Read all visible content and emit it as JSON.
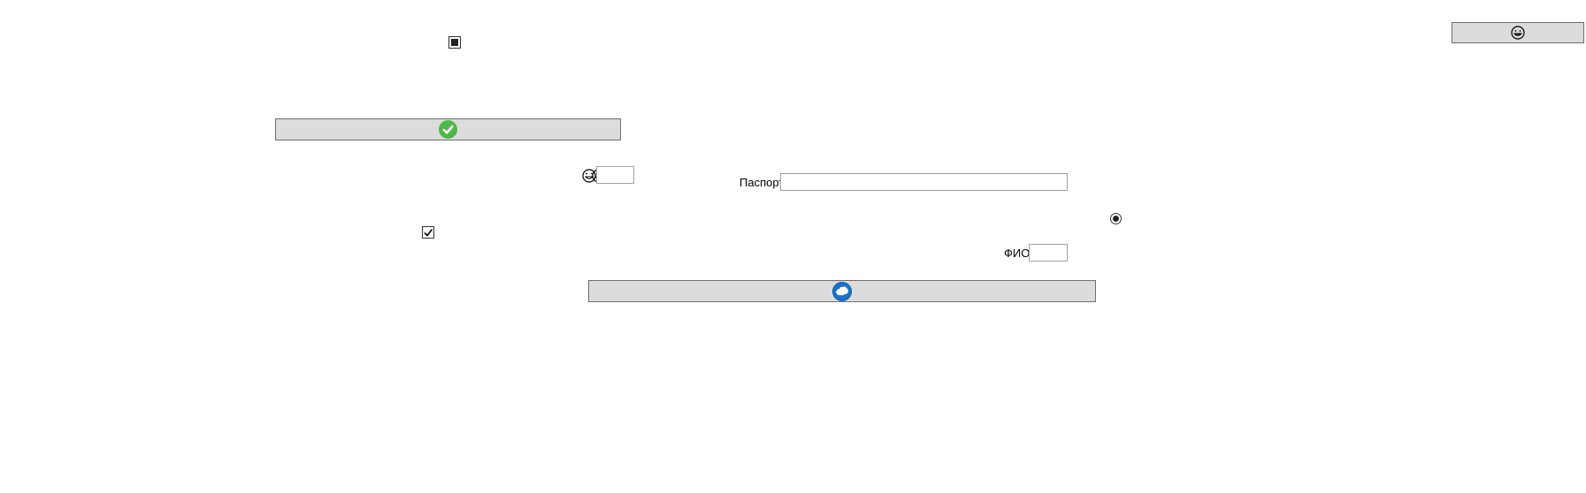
{
  "controls": {
    "top_right_button": {
      "icon": "grinning-face-icon"
    },
    "checkbox_indeterminate": {
      "state": "indeterminate"
    },
    "confirm_button": {
      "icon": "green-checkmark-icon",
      "color": "#4cb847"
    },
    "emoji_pair": {
      "icons": [
        "grinning-face-icon",
        "laughing-face-icon"
      ]
    },
    "small_input": {
      "value": ""
    },
    "passport": {
      "label": "Паспорт",
      "value": ""
    },
    "radio_option": {
      "checked": true
    },
    "checkbox_checked": {
      "checked": true
    },
    "fio": {
      "label": "ФИО",
      "value": ""
    },
    "web_button": {
      "icon": "blue-globe-icon",
      "color": "#1a73c9"
    }
  }
}
